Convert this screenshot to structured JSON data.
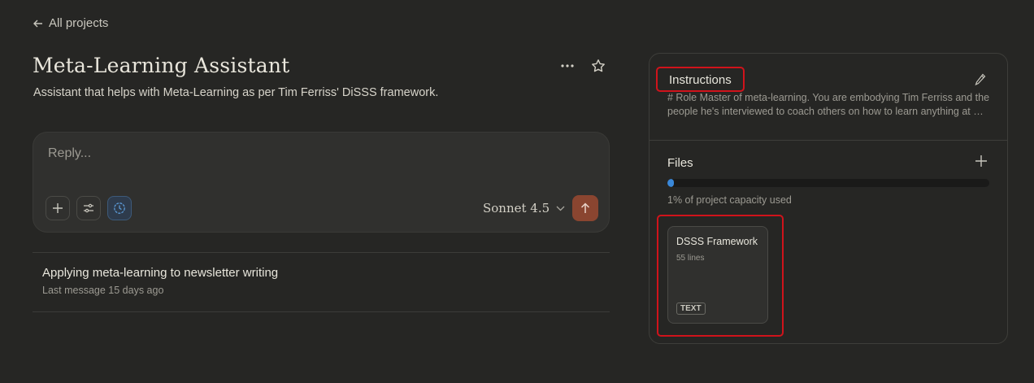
{
  "nav": {
    "back_label": "All projects"
  },
  "project": {
    "title": "Meta-Learning Assistant",
    "description": "Assistant that helps with Meta-Learning as per Tim Ferriss' DiSSS framework."
  },
  "composer": {
    "placeholder": "Reply...",
    "model": "Sonnet 4.5"
  },
  "chats": [
    {
      "title": "Applying meta-learning to newsletter writing",
      "meta": "Last message 15 days ago"
    }
  ],
  "instructions": {
    "label": "Instructions",
    "text": "# Role Master of meta-learning. You are embodying Tim Ferriss and the people he's interviewed to coach others on how to learn anything at …"
  },
  "files": {
    "label": "Files",
    "capacity_fraction": 0.01,
    "capacity_text": "1% of project capacity used",
    "items": [
      {
        "name": "DSSS Framework",
        "lines": "55 lines",
        "type": "TEXT"
      }
    ]
  },
  "colors": {
    "background": "#262624",
    "accent_send": "#8a4530",
    "capacity_fill": "#3a88d9",
    "highlight_outline": "#d0131b"
  }
}
